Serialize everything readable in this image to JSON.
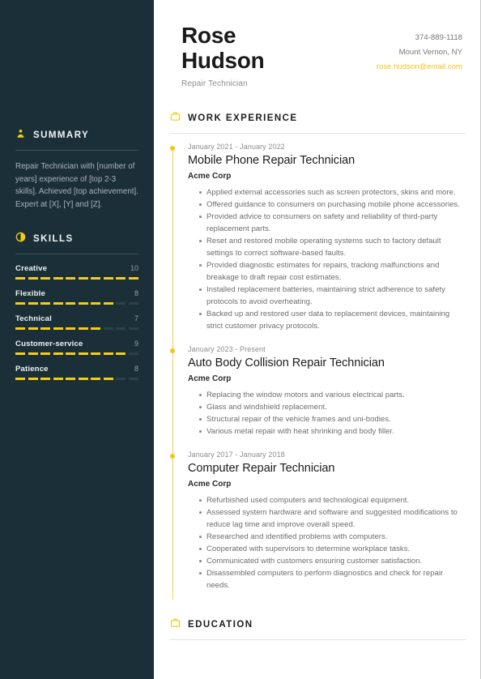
{
  "colors": {
    "sidebar_bg": "#1b2f38",
    "accent": "#f5cd18",
    "accent_email": "#f0c419",
    "page_bg": "#ffffff",
    "body_text": "#6e6e6e"
  },
  "header": {
    "first_name": "Rose",
    "last_name": "Hudson",
    "job_title": "Repair Technician",
    "phone": "374-889-1118",
    "location": "Mount Vernon, NY",
    "email": "rose.hudson@email.com"
  },
  "sidebar": {
    "summary": {
      "icon": "user-icon",
      "label": "SUMMARY",
      "text": "Repair Technician with [number of years] experience of [top 2-3 skills]. Achieved [top achievement]. Expert at [X], [Y] and [Z]."
    },
    "skills": {
      "icon": "pie-chart-icon",
      "label": "SKILLS",
      "max": 10,
      "items": [
        {
          "name": "Creative",
          "score": 10
        },
        {
          "name": "Flexible",
          "score": 8
        },
        {
          "name": "Technical",
          "score": 7
        },
        {
          "name": "Customer-service",
          "score": 9
        },
        {
          "name": "Patience",
          "score": 8
        }
      ]
    }
  },
  "main": {
    "work_experience": {
      "icon": "briefcase-icon",
      "label": "WORK EXPERIENCE",
      "entries": [
        {
          "date": "January 2021 - January 2022",
          "role": "Mobile Phone Repair Technician",
          "company": "Acme Corp",
          "bullets": [
            "Applied external accessories such as screen protectors, skins and more.",
            "Offered guidance to consumers on purchasing mobile phone accessories.",
            "Provided advice to consumers on safety and reliability of third-party replacement parts.",
            "Reset and restored mobile operating systems such to factory default settings to correct software-based faults.",
            "Provided diagnostic estimates for repairs, tracking malfunctions and breakage to draft repair cost estimates.",
            "Installed replacement batteries, maintaining strict adherence to safety protocols to avoid overheating.",
            "Backed up and restored user data to replacement devices, maintaining strict customer privacy protocols."
          ]
        },
        {
          "date": "January 2023 - Present",
          "role": "Auto Body Collision Repair Technician",
          "company": "Acme Corp",
          "bullets": [
            "Replacing the window motors and various electrical parts.",
            "Glass and windshield replacement.",
            "Structural repair of the vehicle frames and uni-bodies.",
            "Various metal repair with heat shrinking and body filler."
          ]
        },
        {
          "date": "January 2017 - January 2018",
          "role": "Computer Repair Technician",
          "company": "Acme Corp",
          "bullets": [
            "Refurbished used computers and technological equipment.",
            "Assessed system hardware and software and suggested modifications to reduce lag time and improve overall speed.",
            "Researched and identified problems with computers.",
            "Cooperated with supervisors to determine workplace tasks.",
            "Communicated with customers ensuring customer satisfaction.",
            "Disassembled computers to perform diagnostics and check for repair needs."
          ]
        }
      ]
    },
    "education": {
      "icon": "briefcase-icon",
      "label": "EDUCATION"
    }
  }
}
